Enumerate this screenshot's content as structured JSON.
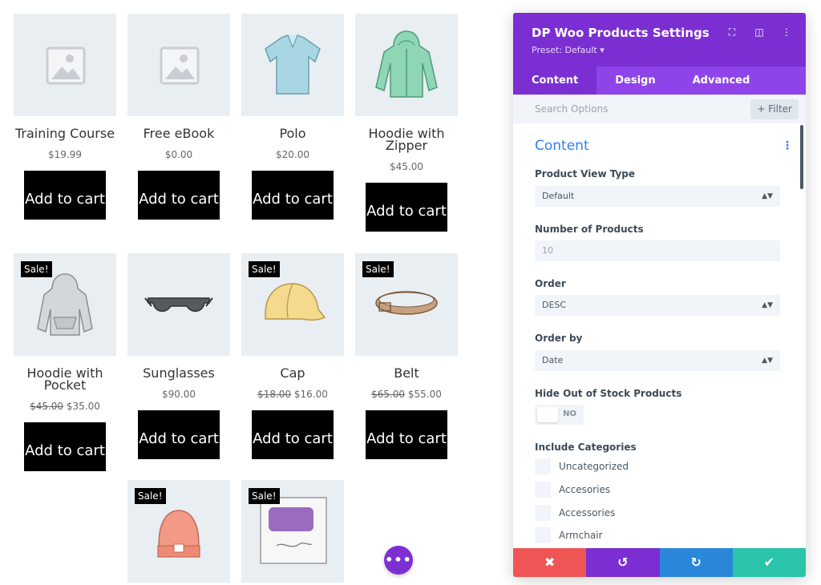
{
  "products": [
    {
      "title": "Training Course",
      "old_price": "",
      "price": "$19.99",
      "sale": false,
      "cart": "Add to cart",
      "image": "placeholder-image-icon"
    },
    {
      "title": "Free eBook",
      "old_price": "",
      "price": "$0.00",
      "sale": false,
      "cart": "Add to cart",
      "image": "placeholder-image-icon"
    },
    {
      "title": "Polo",
      "old_price": "",
      "price": "$20.00",
      "sale": false,
      "cart": "Add to cart",
      "image": "polo-shirt-icon"
    },
    {
      "title": "Hoodie with Zipper",
      "old_price": "",
      "price": "$45.00",
      "sale": false,
      "cart": "Add to cart",
      "image": "zip-hoodie-icon"
    },
    {
      "title": "Hoodie with Pocket",
      "old_price": "$45.00",
      "price": "$35.00",
      "sale": true,
      "sale_label": "Sale!",
      "cart": "Add to cart",
      "image": "pocket-hoodie-icon"
    },
    {
      "title": "Sunglasses",
      "old_price": "",
      "price": "$90.00",
      "sale": false,
      "cart": "Add to cart",
      "image": "sunglasses-icon"
    },
    {
      "title": "Cap",
      "old_price": "$18.00",
      "price": "$16.00",
      "sale": true,
      "sale_label": "Sale!",
      "cart": "Add to cart",
      "image": "cap-icon"
    },
    {
      "title": "Belt",
      "old_price": "$65.00",
      "price": "$55.00",
      "sale": true,
      "sale_label": "Sale!",
      "cart": "Add to cart",
      "image": "belt-icon"
    },
    {
      "title": "",
      "old_price": "",
      "price": "",
      "sale": true,
      "sale_label": "Sale!",
      "cart": "",
      "image": "beanie-icon"
    },
    {
      "title": "",
      "old_price": "",
      "price": "",
      "sale": true,
      "sale_label": "Sale!",
      "cart": "",
      "image": "woo-album-icon"
    }
  ],
  "fab": {
    "label": "•••",
    "icon": "more-options-icon"
  },
  "panel": {
    "title": "DP Woo Products Settings",
    "preset": "Preset: Default ▾",
    "header_icons": [
      "expand-icon",
      "split-view-icon",
      "kebab-menu-icon"
    ],
    "tabs": [
      {
        "label": "Content",
        "active": true
      },
      {
        "label": "Design",
        "active": false
      },
      {
        "label": "Advanced",
        "active": false
      }
    ],
    "search_placeholder": "Search Options",
    "filter_label": "+ Filter",
    "section_title": "Content",
    "fields": {
      "view_type": {
        "label": "Product View Type",
        "value": "Default"
      },
      "num_products": {
        "label": "Number of Products",
        "value": "10"
      },
      "order": {
        "label": "Order",
        "value": "DESC"
      },
      "order_by": {
        "label": "Order by",
        "value": "Date"
      },
      "hide_oos": {
        "label": "Hide Out of Stock Products",
        "value": "NO"
      },
      "categories": {
        "label": "Include Categories",
        "items": [
          "Uncategorized",
          "Accesories",
          "Accessories",
          "Armchair"
        ]
      }
    },
    "footer": {
      "cancel": "✖",
      "undo": "↺",
      "redo": "↻",
      "save": "✔"
    },
    "colors": {
      "purple": "#7b2fd2",
      "tab_bg": "#8e44e8",
      "cancel": "#ef5555",
      "redo": "#2b87da",
      "save": "#29c4a9",
      "accent": "#2f80ed"
    }
  }
}
